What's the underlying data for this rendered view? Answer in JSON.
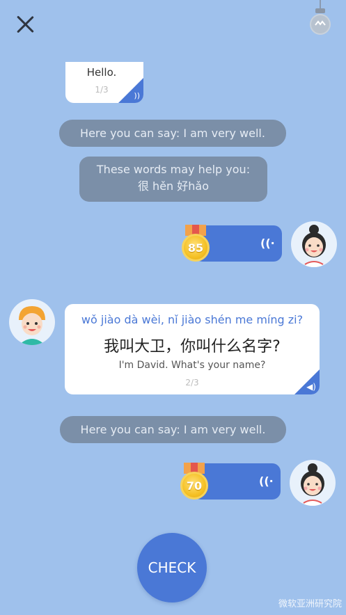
{
  "close": {
    "icon": "close-icon"
  },
  "hint": {
    "icon": "lightbulb-icon"
  },
  "msg1": {
    "text": "Hello.",
    "progress": "1/3",
    "icon": "sound-icon"
  },
  "hint1": {
    "text": "Here you can say: I am very well."
  },
  "hint2": {
    "line1": "These words may help you:",
    "line2": "很 hěn  好hǎo"
  },
  "reply1": {
    "score": "85",
    "icon": "voice-wave-icon"
  },
  "msg2": {
    "pinyin": "wǒ jiào dà wèi, nǐ jiào shén me míng zi?",
    "chinese": "我叫大卫，你叫什么名字?",
    "english": "I'm David. What's your name?",
    "progress": "2/3",
    "icon": "speaker-icon"
  },
  "hint3": {
    "text": "Here you can say: I am very well."
  },
  "reply2": {
    "score": "70",
    "icon": "voice-wave-icon"
  },
  "check": {
    "label": "CHECK"
  },
  "watermark": {
    "text": "微软亚洲研究院"
  },
  "colors": {
    "background": "#9fc1ec",
    "accent": "#4a78d6",
    "pinyin": "#4a78d6",
    "pill": "#7b8fa8"
  }
}
